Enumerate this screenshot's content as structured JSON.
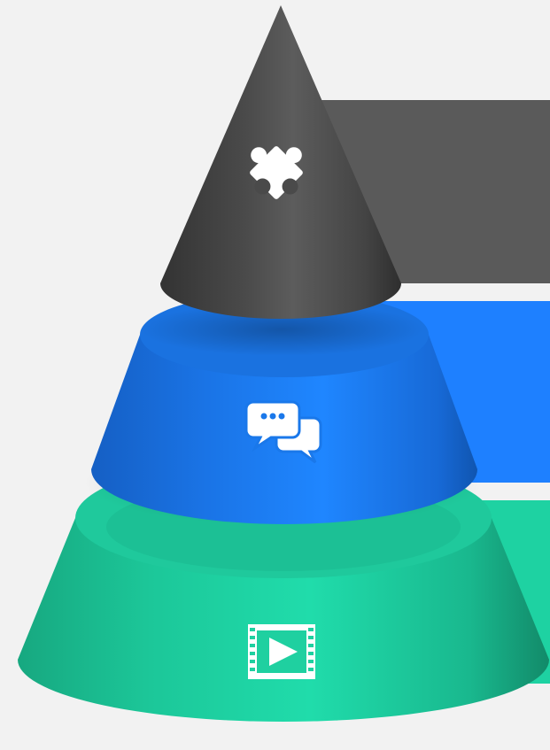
{
  "diagram": {
    "type": "stacked-cone-pyramid",
    "background": "#f2f2f2",
    "tiers": [
      {
        "name": "top",
        "icon": "puzzle-piece-icon",
        "color": "#4a4a4a",
        "band_color": "#5a5a5a"
      },
      {
        "name": "middle",
        "icon": "chat-bubbles-icon",
        "color": "#1e7cf0",
        "band_color": "#1e80ff"
      },
      {
        "name": "bottom",
        "icon": "film-play-icon",
        "color": "#1ed4a4",
        "band_color": "#1ed2a2"
      }
    ]
  }
}
